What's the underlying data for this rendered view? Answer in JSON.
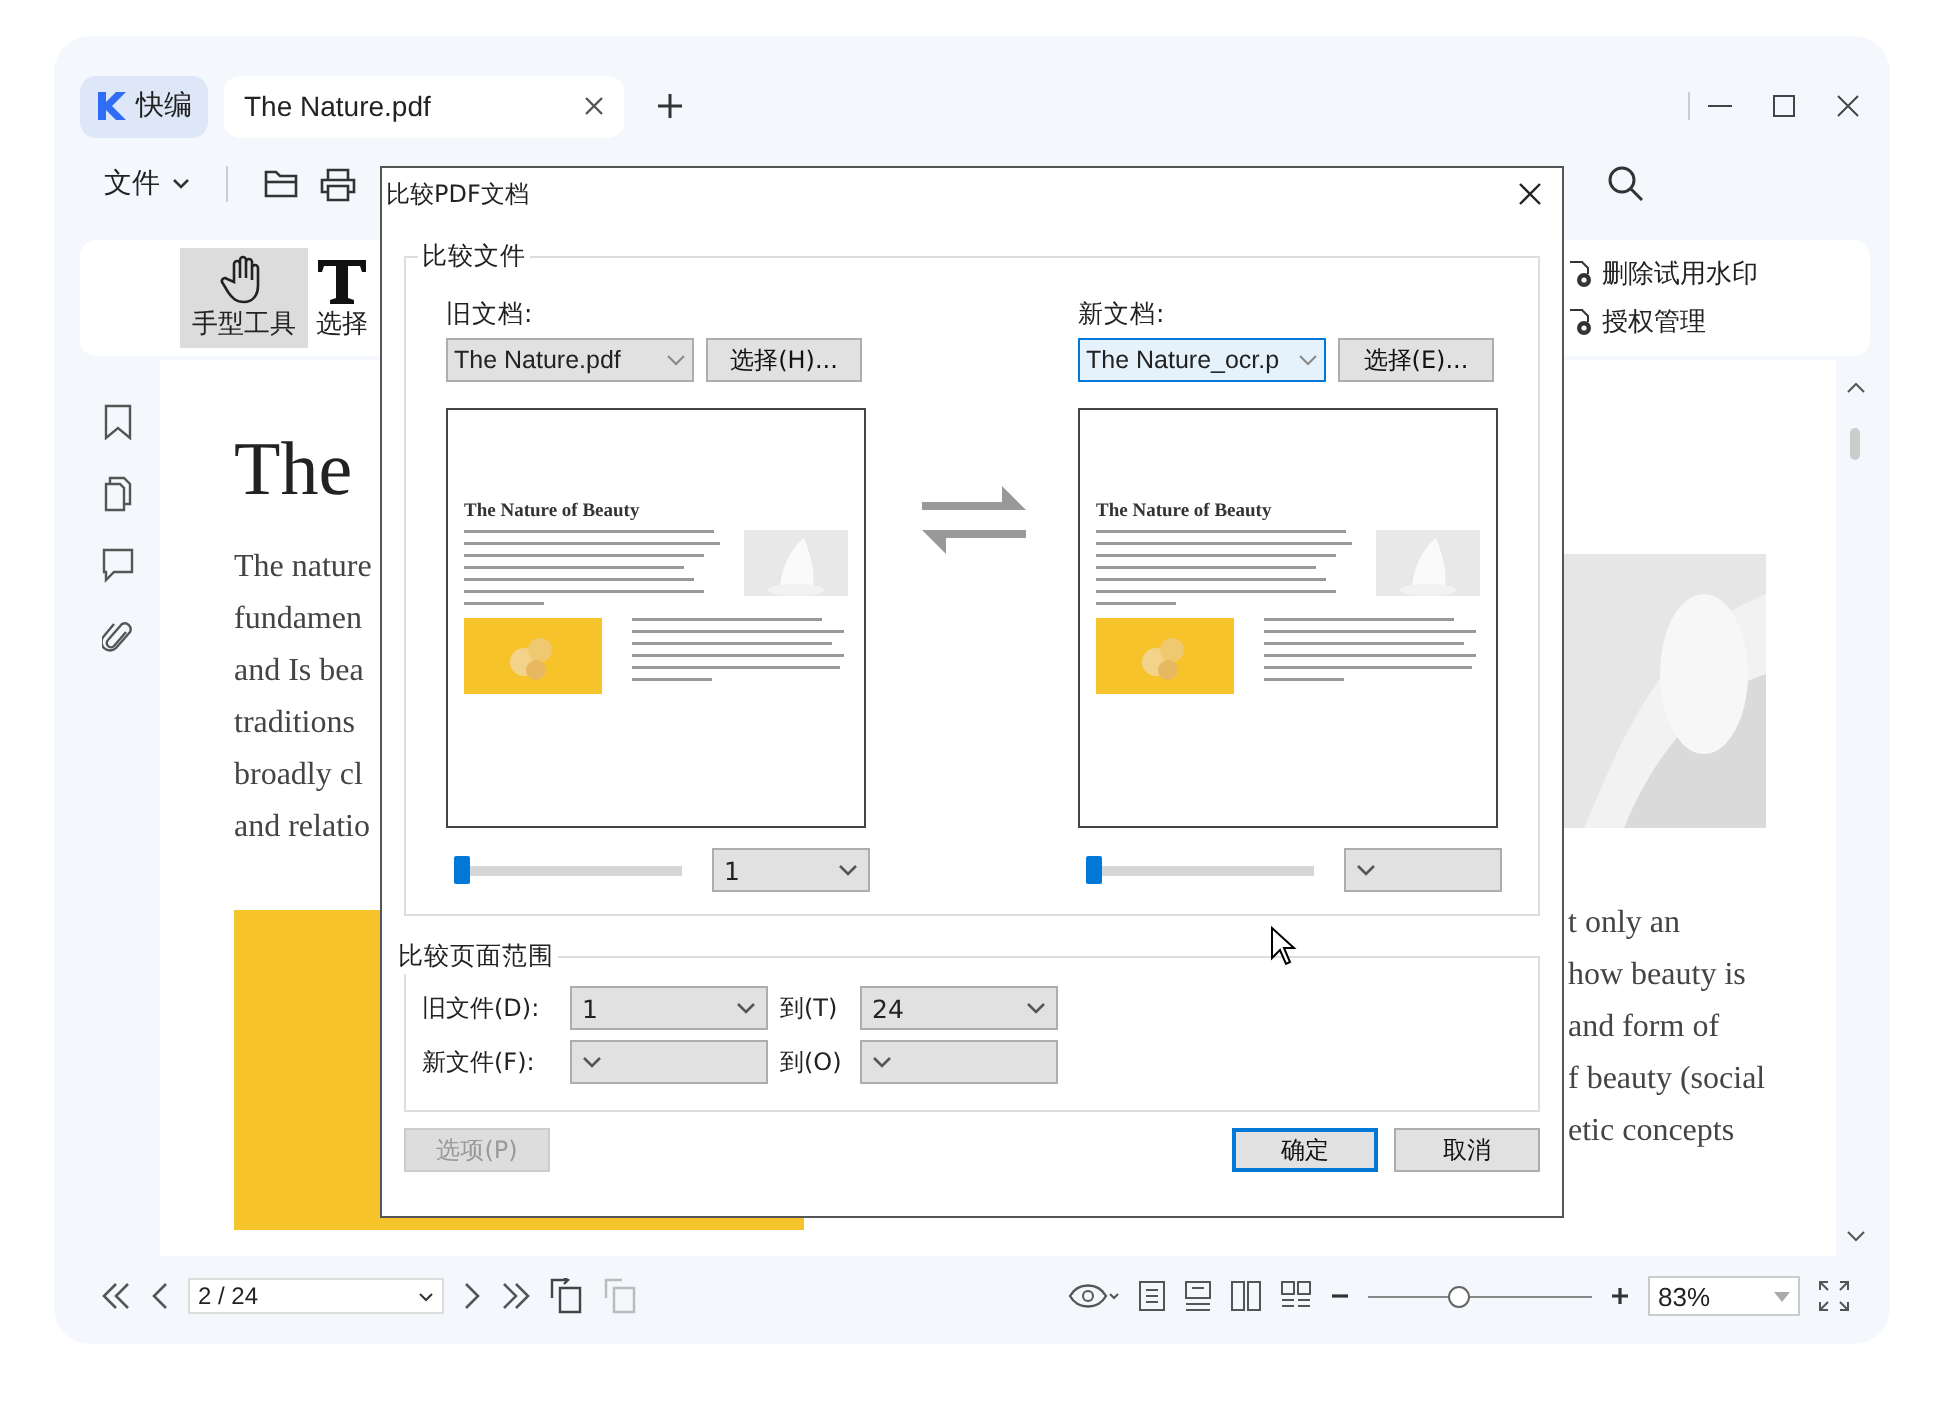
{
  "app_tabs": {
    "logo": "快编",
    "tabs": [
      {
        "label": "The Nature.pdf",
        "selected": true
      }
    ]
  },
  "toolbar": {
    "file_menu": "文件"
  },
  "ribbon": {
    "tools": [
      {
        "kind": "hand",
        "label": "手型工具",
        "selected": true
      },
      {
        "kind": "text",
        "label": "选择",
        "selected": false
      }
    ],
    "actions": [
      "删除试用水印",
      "授权管理"
    ]
  },
  "document": {
    "heading": "The",
    "left_lines": [
      "The nature",
      "fundamen",
      "and Is bea",
      "traditions",
      "broadly cl",
      "and relatio"
    ],
    "right_lines": [
      "t only an",
      "how beauty is",
      "and form of",
      "f beauty (social",
      "etic concepts"
    ]
  },
  "dialog": {
    "title": "比较PDF文档",
    "files_group": "比较文件",
    "docs": [
      {
        "label": "旧文档:",
        "file": "The Nature.pdf",
        "focused": false,
        "button": "选择(H)...",
        "preview_heading": "The Nature of Beauty",
        "level": 0,
        "page": "1"
      },
      {
        "label": "新文档:",
        "file": "The Nature_ocr.p",
        "focused": true,
        "button": "选择(E)...",
        "preview_heading": "The Nature of Beauty",
        "level": 0
      }
    ],
    "range_group": "比较页面范围",
    "ranges": [
      {
        "label": "旧文件(D):",
        "from": "1",
        "to_label": "到(T)",
        "to": "24"
      },
      {
        "label": "新文件(F):",
        "to_label": "到(O)"
      }
    ],
    "buttons": [
      {
        "label": "选项(P)",
        "disabled": true,
        "default": false
      },
      {
        "label": "确定",
        "disabled": false,
        "default": true
      },
      {
        "label": "取消",
        "disabled": false,
        "default": false
      }
    ]
  },
  "bottom_bar": {
    "page": "2 / 24",
    "zoom": {
      "level": 0.4,
      "value": "83%"
    }
  }
}
